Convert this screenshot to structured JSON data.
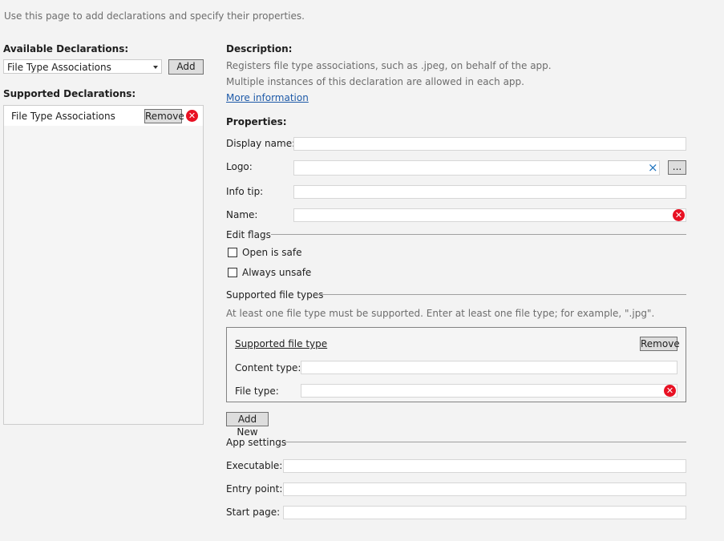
{
  "intro": "Use this page to add declarations and specify their properties.",
  "available": {
    "heading": "Available Declarations:",
    "selected": "File Type Associations",
    "add_label": "Add"
  },
  "supported": {
    "heading": "Supported Declarations:",
    "items": [
      {
        "label": "File Type Associations",
        "remove_label": "Remove"
      }
    ]
  },
  "description": {
    "heading": "Description:",
    "line1": "Registers file type associations, such as .jpeg, on behalf of the app.",
    "line2": "Multiple instances of this declaration are allowed in each app.",
    "more_link": "More information"
  },
  "properties": {
    "heading": "Properties:",
    "display_name": "Display name:",
    "logo": "Logo:",
    "logo_clear": "×",
    "browse": "...",
    "info_tip": "Info tip:",
    "name": "Name:"
  },
  "edit_flags": {
    "heading": "Edit flags",
    "open_is_safe": "Open is safe",
    "always_unsafe": "Always unsafe"
  },
  "file_types": {
    "heading": "Supported file types",
    "hint": "At least one file type must be supported. Enter at least one file type; for example, \".jpg\".",
    "box_title": "Supported file type",
    "remove_label": "Remove",
    "content_type": "Content type:",
    "file_type": "File type:",
    "add_new": "Add New"
  },
  "app_settings": {
    "heading": "App settings",
    "executable": "Executable:",
    "entry_point": "Entry point:",
    "start_page": "Start page:"
  },
  "error_glyph": "✕",
  "colors": {
    "error": "#e81123",
    "link": "#1e5aa8",
    "background": "#f3f3f3"
  }
}
